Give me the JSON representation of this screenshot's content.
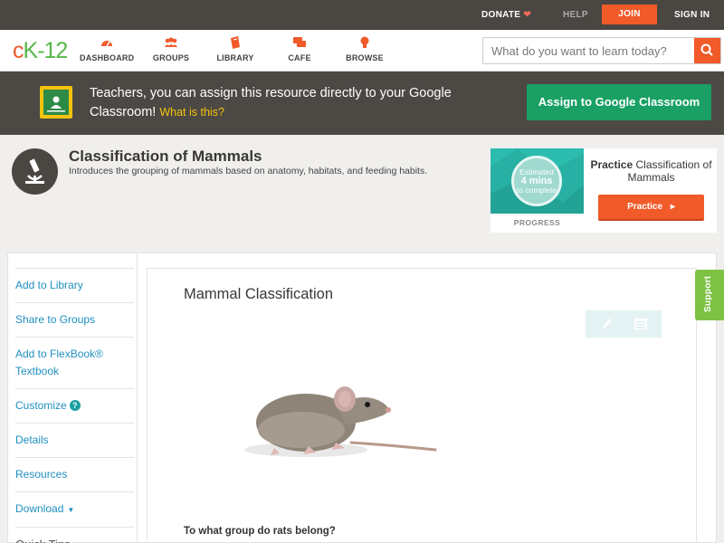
{
  "topbar": {
    "donate": "DONATE",
    "help": "HELP",
    "join": "JOIN",
    "signin": "SIGN IN"
  },
  "nav": {
    "logo": {
      "part1": "c",
      "part2": "K",
      "part3": "-12"
    },
    "items": [
      {
        "label": "DASHBOARD",
        "icon": "dashboard-icon"
      },
      {
        "label": "GROUPS",
        "icon": "groups-icon"
      },
      {
        "label": "LIBRARY",
        "icon": "library-icon"
      },
      {
        "label": "CAFE",
        "icon": "cafe-icon"
      },
      {
        "label": "BROWSE",
        "icon": "browse-icon"
      }
    ],
    "search_placeholder": "What do you want to learn today?"
  },
  "banner": {
    "text": "Teachers, you can assign this resource directly to your Google Classroom!",
    "what_link": "What is this?",
    "assign_button": "Assign to Google Classroom"
  },
  "concept": {
    "title": "Classification of Mammals",
    "description": "Introduces the grouping of mammals based on anatomy, habitats, and feeding habits."
  },
  "practice": {
    "estimated_top": "Estimated",
    "estimated_mid": "4 mins",
    "estimated_bottom": "to complete",
    "progress_label": "PROGRESS",
    "title_bold": "Practice",
    "title_rest": "Classification of Mammals",
    "button": "Practice"
  },
  "sidebar": {
    "items": [
      {
        "label": "Add to Library"
      },
      {
        "label": "Share to Groups"
      },
      {
        "label": "Add to FlexBook® Textbook"
      },
      {
        "label": "Customize"
      },
      {
        "label": "Details"
      },
      {
        "label": "Resources"
      },
      {
        "label": "Download"
      }
    ],
    "quick_tips": "Quick Tips"
  },
  "article": {
    "title": "Mammal Classification",
    "question": "To what group do rats belong?"
  },
  "support": "Support",
  "colors": {
    "accent_orange": "#f15a29",
    "google_green": "#1aa064",
    "link_blue": "#1f8fc0",
    "support_green": "#7dc243"
  }
}
